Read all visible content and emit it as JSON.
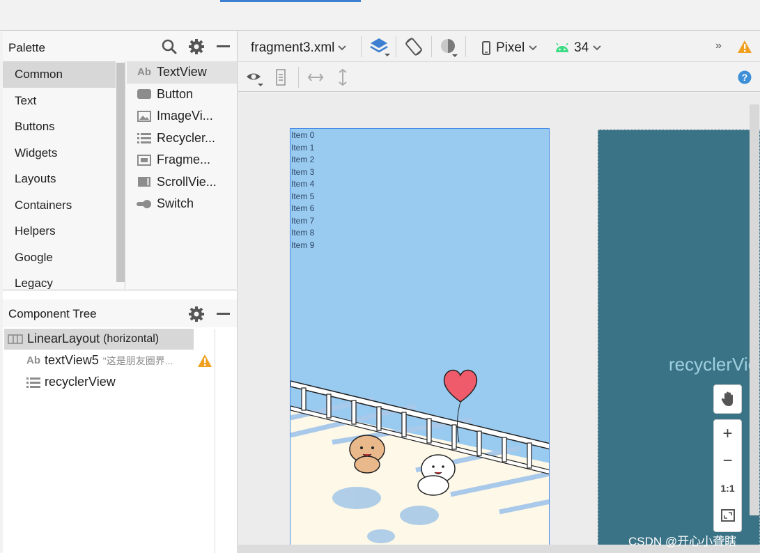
{
  "palette": {
    "title": "Palette",
    "categories": [
      "Common",
      "Text",
      "Buttons",
      "Widgets",
      "Layouts",
      "Containers",
      "Helpers",
      "Google",
      "Legacy"
    ],
    "selected_category": "Common",
    "widgets": [
      {
        "label": "TextView",
        "icon": "textview-icon"
      },
      {
        "label": "Button",
        "icon": "button-icon"
      },
      {
        "label": "ImageVi...",
        "icon": "image-icon"
      },
      {
        "label": "Recycler...",
        "icon": "list-icon"
      },
      {
        "label": "Fragme...",
        "icon": "fragment-icon"
      },
      {
        "label": "ScrollVie...",
        "icon": "scrollview-icon"
      },
      {
        "label": "Switch",
        "icon": "switch-icon"
      }
    ]
  },
  "component_tree": {
    "title": "Component Tree",
    "root": {
      "label": "LinearLayout",
      "sublabel": "(horizontal)"
    },
    "children": [
      {
        "label": "textView5",
        "preview": "\"这是朋友圈界...",
        "warning": true
      },
      {
        "label": "recyclerView"
      }
    ]
  },
  "toolbar": {
    "file": "fragment3.xml",
    "device": "Pixel",
    "api_level": "34",
    "more": "»"
  },
  "preview": {
    "items": [
      "Item 0",
      "Item 1",
      "Item 2",
      "Item 3",
      "Item 4",
      "Item 5",
      "Item 6",
      "Item 7",
      "Item 8",
      "Item 9"
    ]
  },
  "blueprint": {
    "label": "recyclerVie"
  },
  "zoom": {
    "plus": "+",
    "minus": "−",
    "actual": "1:1"
  },
  "watermark": "CSDN @开心小聋瞎",
  "colors": {
    "accent": "#3d7fd0",
    "preview_bg": "#99caf0",
    "blueprint_bg": "#3b7386",
    "warning": "#f0a020"
  }
}
